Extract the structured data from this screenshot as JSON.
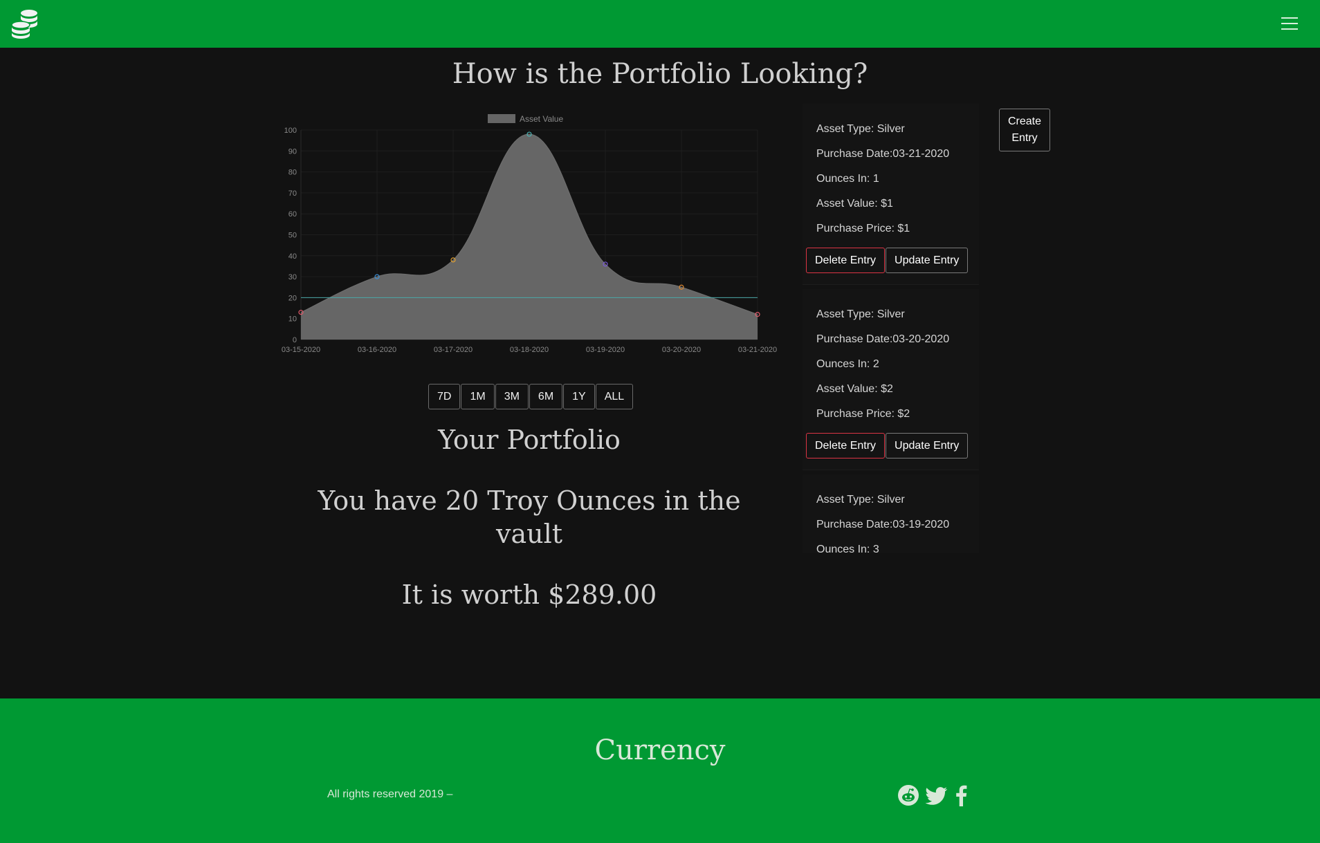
{
  "header": {
    "logo_icon": "coins-stack-icon",
    "menu_icon": "hamburger-icon"
  },
  "page_title": "How is the Portfolio Looking?",
  "chart_data": {
    "type": "area",
    "legend": [
      "Asset Value"
    ],
    "legend_position": "top",
    "x": [
      "03-15-2020",
      "03-16-2020",
      "03-17-2020",
      "03-18-2020",
      "03-19-2020",
      "03-20-2020",
      "03-21-2020"
    ],
    "series": [
      {
        "name": "Asset Value",
        "values": [
          13,
          30,
          38,
          98,
          36,
          25,
          12
        ],
        "fill": "#666666"
      }
    ],
    "reference_line": {
      "value": 20,
      "color": "#4aa8a8"
    },
    "point_colors": [
      "#e05a6a",
      "#3b8fd6",
      "#e0a030",
      "#4ab0b0",
      "#7a5ad6",
      "#e08a30",
      "#e05a6a"
    ],
    "ylim": [
      0,
      100
    ],
    "yticks": [
      0,
      10,
      20,
      30,
      40,
      50,
      60,
      70,
      80,
      90,
      100
    ],
    "grid": true,
    "xlabel": "",
    "ylabel": ""
  },
  "range_buttons": [
    "7D",
    "1M",
    "3M",
    "6M",
    "1Y",
    "ALL"
  ],
  "portfolio": {
    "heading": "Your Portfolio",
    "ounces_text": "You have 20 Troy Ounces in the vault",
    "worth_text": "It is worth $289.00"
  },
  "entries": [
    {
      "type": "Asset Type: Silver",
      "date": "Purchase Date:03-21-2020",
      "ounces": "Ounces In: 1",
      "value": "Asset Value: $1",
      "price": "Purchase Price: $1",
      "delete_label": "Delete Entry",
      "update_label": "Update Entry"
    },
    {
      "type": "Asset Type: Silver",
      "date": "Purchase Date:03-20-2020",
      "ounces": "Ounces In: 2",
      "value": "Asset Value: $2",
      "price": "Purchase Price: $2",
      "delete_label": "Delete Entry",
      "update_label": "Update Entry"
    },
    {
      "type": "Asset Type: Silver",
      "date": "Purchase Date:03-19-2020",
      "ounces": "Ounces In: 3",
      "value": "",
      "price": "",
      "delete_label": "",
      "update_label": ""
    }
  ],
  "create_button": "Create Entry",
  "footer": {
    "brand": "Currency",
    "copyright": "All rights reserved 2019 –",
    "social_icons": [
      "reddit-icon",
      "twitter-icon",
      "facebook-icon"
    ]
  },
  "colors": {
    "brand_green": "#009933",
    "background": "#121212",
    "delete_border": "#dc3545"
  }
}
